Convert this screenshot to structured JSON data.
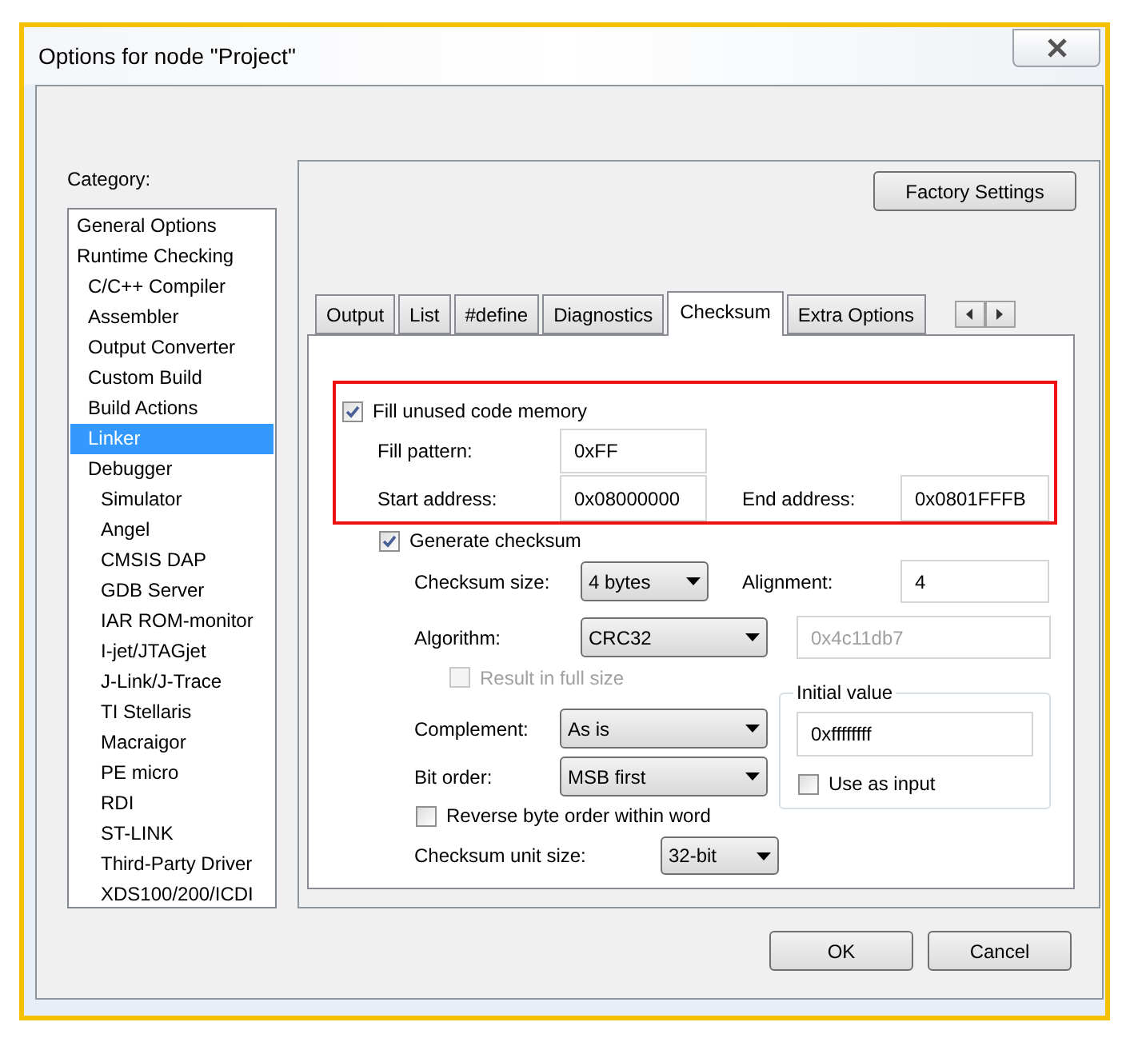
{
  "window": {
    "title": "Options for node \"Project\""
  },
  "category": {
    "label": "Category:",
    "items": [
      {
        "label": "General Options",
        "selected": false
      },
      {
        "label": "Runtime Checking",
        "selected": false,
        "children": [
          {
            "label": "C/C++ Compiler",
            "selected": false
          },
          {
            "label": "Assembler",
            "selected": false
          },
          {
            "label": "Output Converter",
            "selected": false
          },
          {
            "label": "Custom Build",
            "selected": false
          },
          {
            "label": "Build Actions",
            "selected": false
          },
          {
            "label": "Linker",
            "selected": true
          },
          {
            "label": "Debugger",
            "selected": false,
            "children": [
              {
                "label": "Simulator",
                "selected": false
              },
              {
                "label": "Angel",
                "selected": false
              },
              {
                "label": "CMSIS DAP",
                "selected": false
              },
              {
                "label": "GDB Server",
                "selected": false
              },
              {
                "label": "IAR ROM-monitor",
                "selected": false
              },
              {
                "label": "I-jet/JTAGjet",
                "selected": false
              },
              {
                "label": "J-Link/J-Trace",
                "selected": false
              },
              {
                "label": "TI Stellaris",
                "selected": false
              },
              {
                "label": "Macraigor",
                "selected": false
              },
              {
                "label": "PE micro",
                "selected": false
              },
              {
                "label": "RDI",
                "selected": false
              },
              {
                "label": "ST-LINK",
                "selected": false
              },
              {
                "label": "Third-Party Driver",
                "selected": false
              },
              {
                "label": "XDS100/200/ICDI",
                "selected": false
              }
            ]
          }
        ]
      }
    ]
  },
  "factory_settings": "Factory Settings",
  "tabs": [
    {
      "label": "Output",
      "selected": false
    },
    {
      "label": "List",
      "selected": false
    },
    {
      "label": "#define",
      "selected": false
    },
    {
      "label": "Diagnostics",
      "selected": false
    },
    {
      "label": "Checksum",
      "selected": true
    },
    {
      "label": "Extra Options",
      "selected": false
    }
  ],
  "fill": {
    "label": "Fill unused code memory",
    "checked": true,
    "fill_pattern": {
      "label": "Fill pattern:",
      "value": "0xFF"
    },
    "start_address": {
      "label": "Start address:",
      "value": "0x08000000"
    },
    "end_address": {
      "label": "End address:",
      "value": "0x0801FFFB"
    }
  },
  "checksum": {
    "generate": {
      "label": "Generate checksum",
      "checked": true
    },
    "size": {
      "label": "Checksum size:",
      "value": "4 bytes"
    },
    "alignment": {
      "label": "Alignment:",
      "value": "4"
    },
    "algorithm": {
      "label": "Algorithm:",
      "value": "CRC32"
    },
    "polynomial": {
      "value": "0x4c11db7",
      "disabled": true
    },
    "result_full_size": {
      "label": "Result in full size",
      "checked": false,
      "disabled": true
    },
    "complement": {
      "label": "Complement:",
      "value": "As is"
    },
    "bit_order": {
      "label": "Bit order:",
      "value": "MSB first"
    },
    "initial_value": {
      "title": "Initial value",
      "value": "0xffffffff",
      "use_as_input": {
        "label": "Use as input",
        "checked": false
      }
    },
    "reverse_byte_order": {
      "label": "Reverse byte order within word",
      "checked": false
    },
    "unit_size": {
      "label": "Checksum unit size:",
      "value": "32-bit"
    }
  },
  "buttons": [
    {
      "label": "OK"
    },
    {
      "label": "Cancel"
    }
  ]
}
